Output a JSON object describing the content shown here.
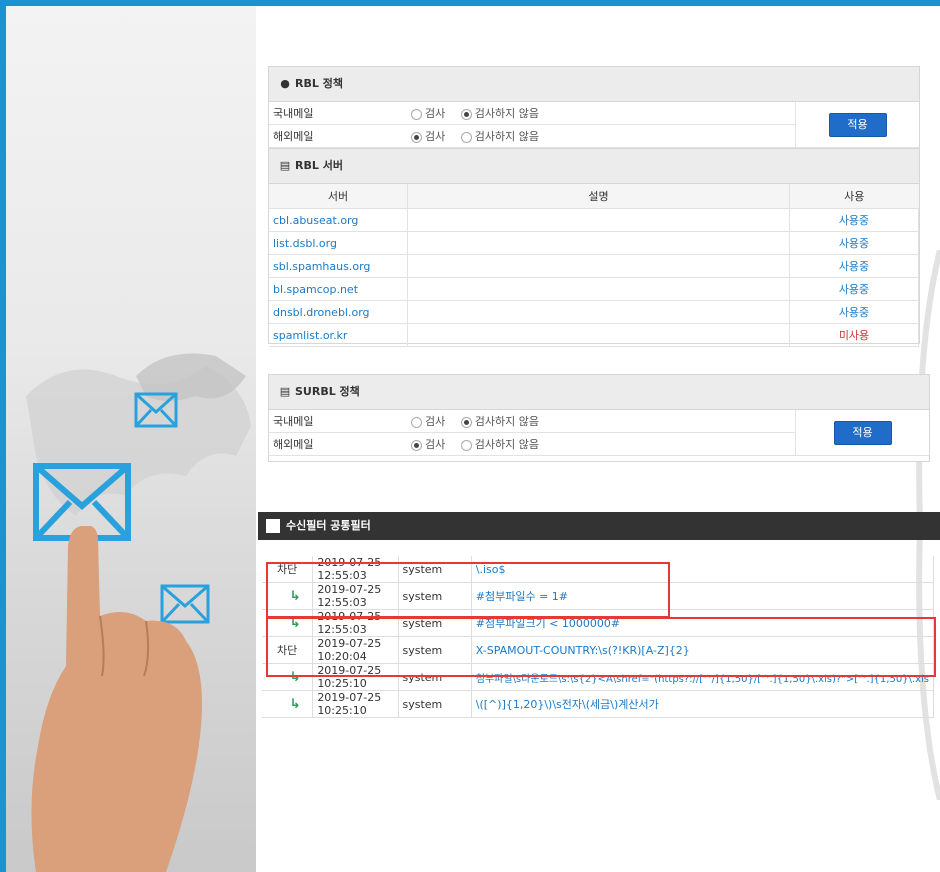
{
  "rbl_policy": {
    "title": "RBL 정책",
    "rows": [
      {
        "label": "국내메일",
        "opt1": "검사",
        "opt2": "검사하지 않음",
        "selected": "opt2"
      },
      {
        "label": "해외메일",
        "opt1": "검사",
        "opt2": "검사하지 않음",
        "selected": "opt1"
      }
    ],
    "apply_label": "적용"
  },
  "rbl_servers": {
    "title": "RBL 서버",
    "headers": {
      "server": "서버",
      "desc": "설명",
      "use": "사용"
    },
    "rows": [
      {
        "server": "cbl.abuseat.org",
        "desc": "",
        "use": "사용중",
        "active": true
      },
      {
        "server": "list.dsbl.org",
        "desc": "",
        "use": "사용중",
        "active": true
      },
      {
        "server": "sbl.spamhaus.org",
        "desc": "",
        "use": "사용중",
        "active": true
      },
      {
        "server": "bl.spamcop.net",
        "desc": "",
        "use": "사용중",
        "active": true
      },
      {
        "server": "dnsbl.dronebl.org",
        "desc": "",
        "use": "사용중",
        "active": true
      },
      {
        "server": "spamlist.or.kr",
        "desc": "",
        "use": "미사용",
        "active": false
      }
    ]
  },
  "surbl_policy": {
    "title": "SURBL 정책",
    "rows": [
      {
        "label": "국내메일",
        "opt1": "검사",
        "opt2": "검사하지 않음",
        "selected": "opt2"
      },
      {
        "label": "해외메일",
        "opt1": "검사",
        "opt2": "검사하지 않음",
        "selected": "opt1"
      }
    ],
    "apply_label": "적용"
  },
  "filter": {
    "title": "수신필터 공통필터",
    "rows": [
      {
        "action": "차단",
        "date": "2019-07-25 12:55:03",
        "user": "system",
        "pattern": "\\.iso$",
        "child": false
      },
      {
        "action": "",
        "date": "2019-07-25 12:55:03",
        "user": "system",
        "pattern": "#첨부파일수 = 1#",
        "child": true
      },
      {
        "action": "",
        "date": "2019-07-25 12:55:03",
        "user": "system",
        "pattern": "#첨부파일크기 < 1000000#",
        "child": true
      },
      {
        "action": "차단",
        "date": "2019-07-25 10:20:04",
        "user": "system",
        "pattern": "X-SPAMOUT-COUNTRY:\\s(?!KR)[A-Z]{2}",
        "child": false
      },
      {
        "action": "",
        "date": "2019-07-25 10:25:10",
        "user": "system",
        "pattern": "첨부파일\\s다운로드\\s:\\s{2}<A\\shref=\"(https?://[^/]{1,50}/[^.]{1,50}\\.xls)?\">[^.]{1,50}\\.xls",
        "child": true
      },
      {
        "action": "",
        "date": "2019-07-25 10:25:10",
        "user": "system",
        "pattern": "\\([^)]{1,20}\\)\\s전자\\(세금\\)계산서가",
        "child": true
      }
    ]
  },
  "colors": {
    "accent": "#1a93d4",
    "button": "#1f6cc9",
    "link": "#1a7ac7",
    "unused": "#d32f2f",
    "highlight": "#e53935"
  }
}
